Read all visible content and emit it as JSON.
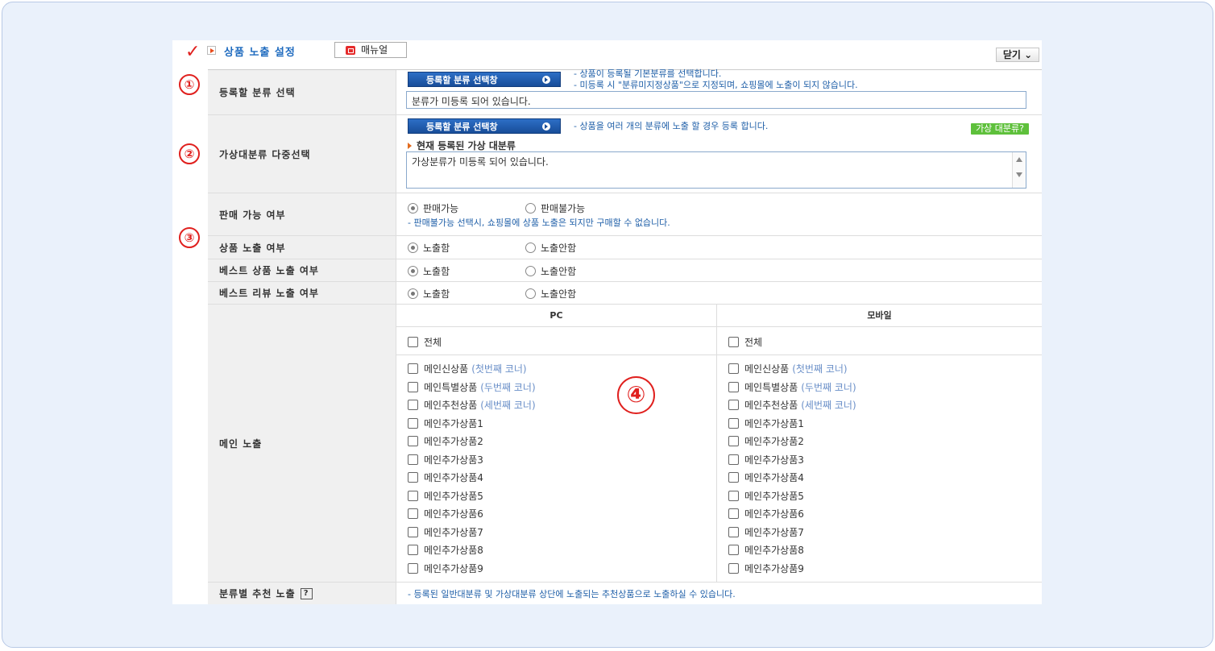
{
  "header": {
    "title": "상품 노출 설정",
    "manual_label": "매뉴얼",
    "close_label": "닫기 ⌄"
  },
  "markers": [
    "①",
    "②",
    "③",
    "④"
  ],
  "category": {
    "label": "등록할 분류 선택",
    "button": "등록할 분류 선택창",
    "note1": "- 상품이 등록될 기본분류를 선택합니다.",
    "note2": "- 미등록 시 \"분류미지정상품\"으로 지정되며, 쇼핑몰에 노출이 되지 않습니다.",
    "value": "분류가 미등록 되어 있습니다."
  },
  "virtual": {
    "label": "가상대분류 다중선택",
    "button": "등록할 분류 선택창",
    "note": "- 상품을 여러 개의 분류에 노출 할 경우 등록 합니다.",
    "help_badge": "가상 대분류?",
    "subhead": "현재 등록된 가상 대분류",
    "value": "가상분류가 미등록 되어 있습니다."
  },
  "sale": {
    "label": "판매 가능 여부",
    "opt_yes": "판매가능",
    "opt_no": "판매불가능",
    "note": "- 판매불가능 선택시, 쇼핑몰에 상품 노출은 되지만 구매할 수 없습니다."
  },
  "exposure_rows": [
    {
      "label": "상품 노출 여부",
      "on": "노출함",
      "off": "노출안함"
    },
    {
      "label": "베스트 상품 노출 여부",
      "on": "노출함",
      "off": "노출안함"
    },
    {
      "label": "베스트 리뷰 노출 여부",
      "on": "노출함",
      "off": "노출안함"
    }
  ],
  "main": {
    "label": "메인 노출",
    "pc_header": "PC",
    "mobile_header": "모바일",
    "all_label": "전체",
    "items": [
      {
        "name": "메인신상품",
        "hint": "(첫번째 코너)"
      },
      {
        "name": "메인특별상품",
        "hint": "(두번째 코너)"
      },
      {
        "name": "메인추천상품",
        "hint": "(세번째 코너)"
      },
      {
        "name": "메인추가상품1",
        "hint": ""
      },
      {
        "name": "메인추가상품2",
        "hint": ""
      },
      {
        "name": "메인추가상품3",
        "hint": ""
      },
      {
        "name": "메인추가상품4",
        "hint": ""
      },
      {
        "name": "메인추가상품5",
        "hint": ""
      },
      {
        "name": "메인추가상품6",
        "hint": ""
      },
      {
        "name": "메인추가상품7",
        "hint": ""
      },
      {
        "name": "메인추가상품8",
        "hint": ""
      },
      {
        "name": "메인추가상품9",
        "hint": ""
      }
    ]
  },
  "recommend": {
    "label": "분류별 추천 노출",
    "help": "?",
    "note": "- 등록된 일반대분류 및 가상대분류 상단에 노출되는 추천상품으로 노출하실 수 있습니다."
  }
}
